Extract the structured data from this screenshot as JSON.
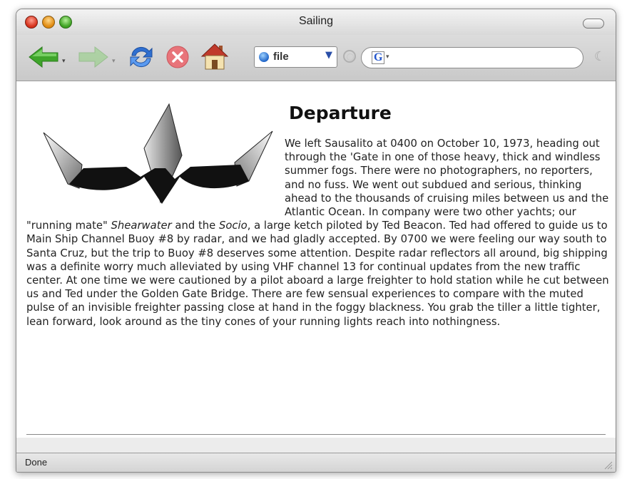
{
  "window": {
    "title": "Sailing"
  },
  "toolbar": {
    "protocol_label": "file",
    "search_value": "",
    "icons": [
      "back-icon",
      "forward-icon",
      "reload-icon",
      "stop-icon",
      "home-icon",
      "globe-icon",
      "go-icon",
      "google-search-icon",
      "spinner-icon"
    ]
  },
  "content": {
    "heading": "Departure",
    "paragraph_parts": [
      "We left Sausalito at 0400 on October 10, 1973, heading out through the 'Gate in one of those heavy, thick and windless summer fogs. There were no photographers, no reporters, and no fuss. We went out subdued and serious, thinking ahead to the thousands of cruising miles between us and the Atlantic Ocean. In company were two other yachts; our \"running mate\" ",
      "Shearwater",
      " and the ",
      "Socio",
      ", a large ketch piloted by Ted Beacon. Ted had offered to guide us to Main Ship Channel Buoy #8 by radar, and we had gladly accepted. By 0700 we were feeling our way south to Santa Cruz, but the trip to Buoy #8 deserves some attention. Despite radar reflectors all around, big shipping was a definite worry much alleviated by using VHF channel 13 for continual updates from the new traffic center. At one time we were cautioned by a pilot aboard a large freighter to hold station while he cut between us and Ted under the Golden Gate Bridge. There are few sensual experiences to compare with the muted pulse of an invisible freighter passing close at hand in the foggy blackness. You grab the tiller a little tighter, lean forward, look around as the tiny cones of your running lights reach into nothingness."
    ]
  },
  "status": {
    "text": "Done"
  },
  "colors": {
    "back_arrow": "#3fa52b",
    "forward_arrow": "#8fd07e",
    "reload": "#2f6fd0",
    "stop": "#e8747a"
  }
}
